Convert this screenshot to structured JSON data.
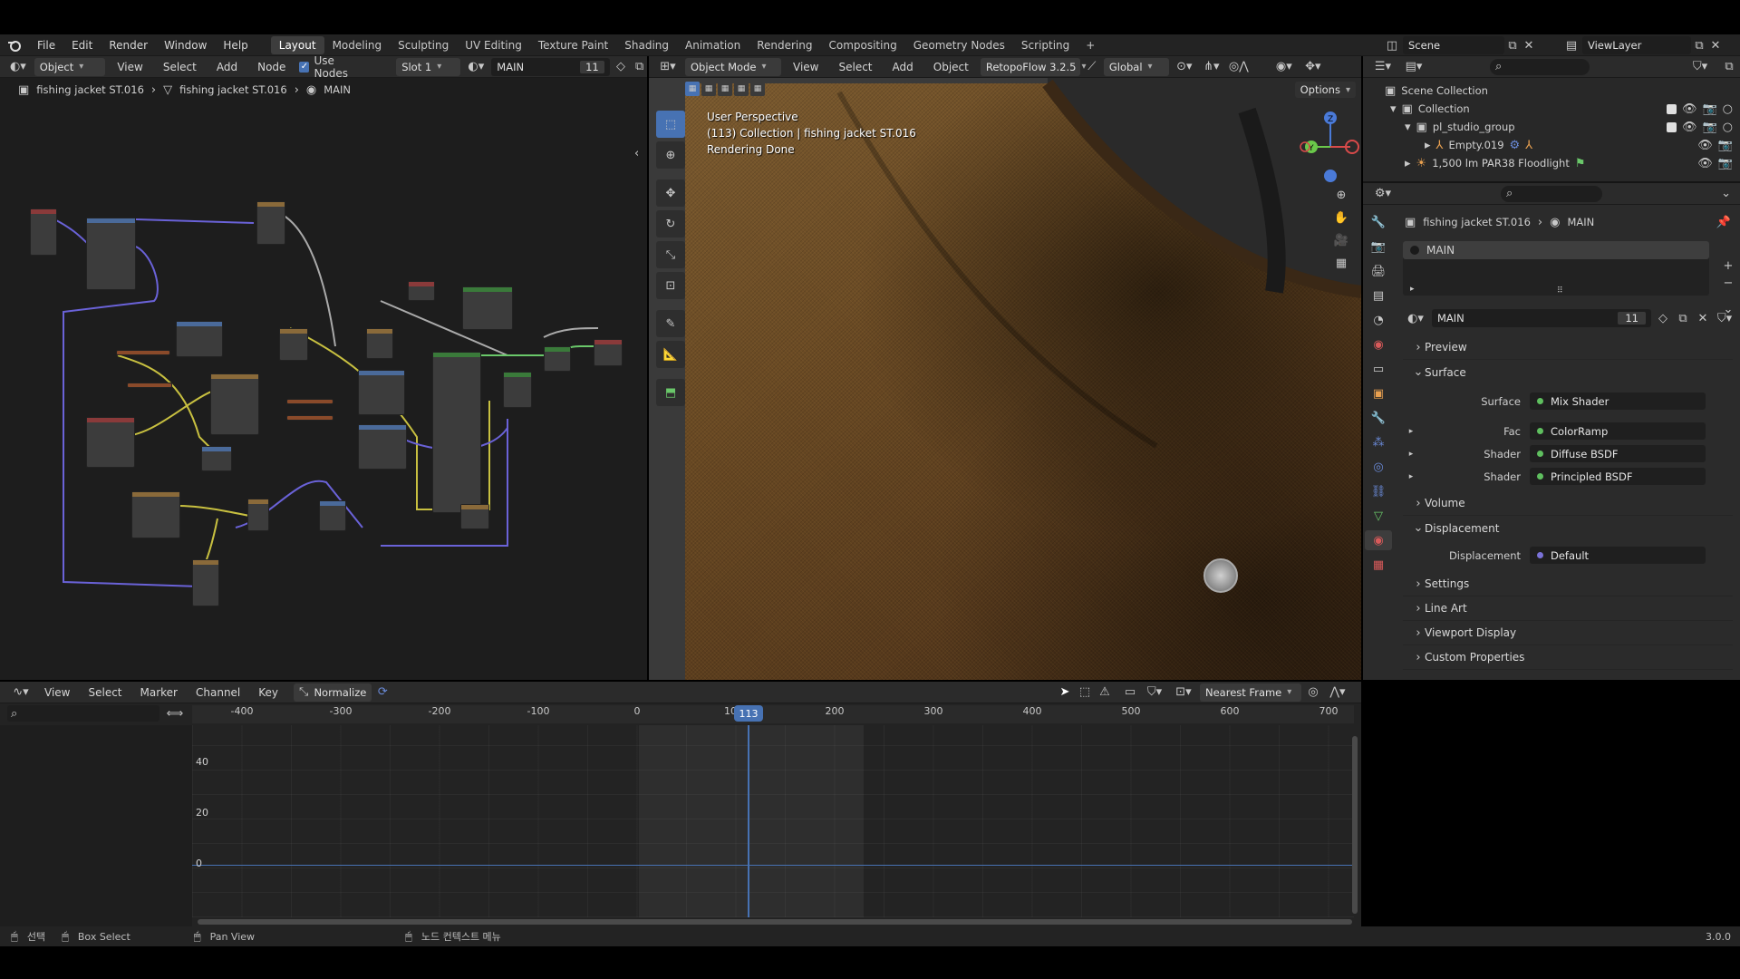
{
  "menubar": {
    "items": [
      "File",
      "Edit",
      "Render",
      "Window",
      "Help"
    ],
    "workspaces": [
      "Layout",
      "Modeling",
      "Sculpting",
      "UV Editing",
      "Texture Paint",
      "Shading",
      "Animation",
      "Rendering",
      "Compositing",
      "Geometry Nodes",
      "Scripting"
    ],
    "active_workspace": "Layout",
    "scene": "Scene",
    "view_layer": "ViewLayer"
  },
  "node_editor": {
    "header": {
      "object_label": "Object",
      "menus": [
        "View",
        "Select",
        "Add",
        "Node"
      ],
      "use_nodes": "Use Nodes",
      "slot": "Slot 1",
      "material": "MAIN",
      "users": "11"
    },
    "breadcrumb": [
      "fishing jacket ST.016",
      "fishing jacket ST.016",
      "MAIN"
    ]
  },
  "viewport": {
    "header": {
      "mode": "Object Mode",
      "menus": [
        "View",
        "Select",
        "Add",
        "Object"
      ],
      "addon": "RetopoFlow 3.2.5",
      "orientation": "Global",
      "options": "Options"
    },
    "overlay_text": [
      "User Perspective",
      "(113) Collection | fishing jacket ST.016",
      "Rendering Done"
    ]
  },
  "outliner": {
    "root": "Scene Collection",
    "items": [
      {
        "label": "Collection"
      },
      {
        "label": "pl_studio_group"
      },
      {
        "label": "Empty.019"
      },
      {
        "label": "1,500 lm PAR38 Floodlight"
      }
    ]
  },
  "properties": {
    "breadcrumb": [
      "fishing jacket ST.016",
      "MAIN"
    ],
    "slot_name": "MAIN",
    "material": "MAIN",
    "users": "11",
    "sections": {
      "preview": "Preview",
      "surface": "Surface",
      "volume": "Volume",
      "displacement": "Displacement",
      "settings": "Settings",
      "line_art": "Line Art",
      "viewport_display": "Viewport Display",
      "custom_properties": "Custom Properties"
    },
    "surface_rows": [
      {
        "label": "Surface",
        "value": "Mix Shader"
      },
      {
        "label": "Fac",
        "value": "ColorRamp"
      },
      {
        "label": "Shader",
        "value": "Diffuse BSDF"
      },
      {
        "label": "Shader",
        "value": "Principled BSDF"
      }
    ],
    "displacement_row": {
      "label": "Displacement",
      "value": "Default"
    }
  },
  "graph_editor": {
    "menus": [
      "View",
      "Select",
      "Marker",
      "Channel",
      "Key"
    ],
    "normalize": "Normalize",
    "snap": "Nearest Frame",
    "frame_ticks": [
      "-400",
      "-300",
      "-200",
      "-100",
      "0",
      "10",
      "200",
      "300",
      "400",
      "500",
      "600",
      "700"
    ],
    "current_frame": "113",
    "y_ticks": [
      "40",
      "20",
      "0"
    ]
  },
  "statusbar": {
    "items": [
      "선택",
      "Box Select",
      "Pan View",
      "노드 컨텍스트 메뉴"
    ],
    "version": "3.0.0"
  },
  "colors": {
    "accent": "#4772b3",
    "fabric": "#5a3f22",
    "node_link_yellow": "#c8c040",
    "node_link_purple": "#6a62d8",
    "node_link_green": "#6ac86a"
  }
}
